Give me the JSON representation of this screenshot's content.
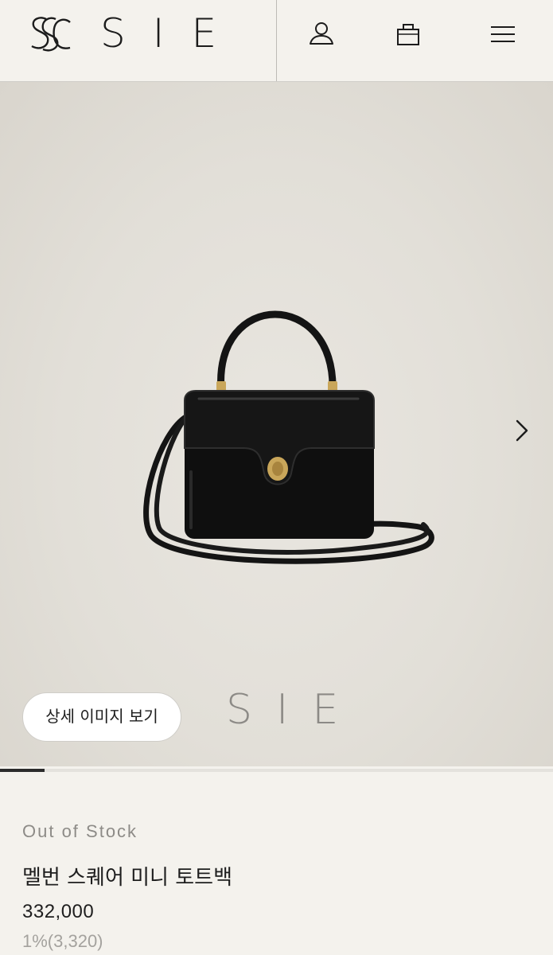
{
  "header": {
    "brand": "SIE",
    "icons": [
      "account-icon",
      "shopping-bag-icon",
      "menu-icon"
    ]
  },
  "hero": {
    "watermark": "SIE",
    "detail_button_label": "상세 이미지 보기",
    "carousel_progress": 0.08
  },
  "product": {
    "stock_status": "Out of Stock",
    "name": "멜번 스퀘어 미니 토트백",
    "price": "332,000",
    "points": "1%(3,320)"
  },
  "colors": {
    "background": "#f4f2ed",
    "hero_bg": "#e2dfd8",
    "text": "#1c1c1c",
    "muted": "#8d8b87"
  }
}
